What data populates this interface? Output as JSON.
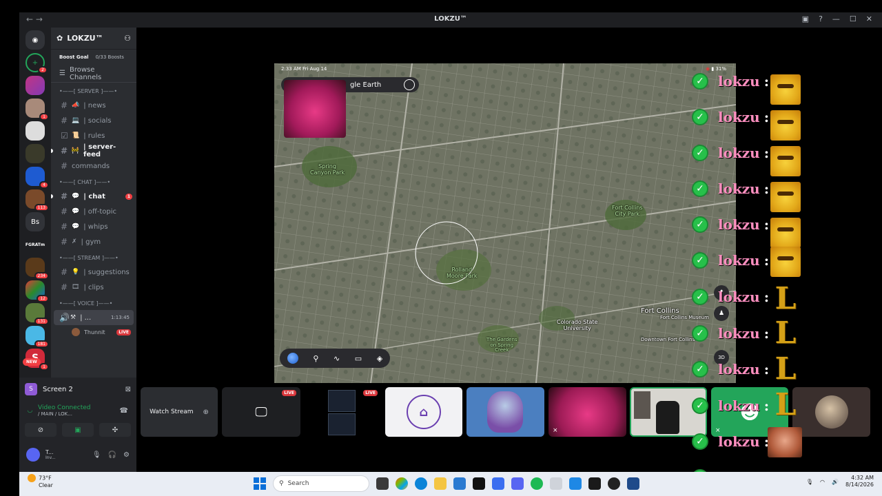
{
  "window": {
    "title": "LOKZU™",
    "back": "←",
    "forward": "→"
  },
  "guild_rail": {
    "badges": [
      "2",
      "1",
      "4",
      "113",
      "234",
      "12",
      "131",
      "181",
      "1"
    ],
    "bs_label": "Bs",
    "grat_label": "FGRATm",
    "new_label": "NEW"
  },
  "server": {
    "name": "LOKZU™",
    "boost_goal": "Boost Goal",
    "boost_count": "0/33 Boosts",
    "browse": "Browse Channels"
  },
  "categories": {
    "server": "•——[ SERVER ]——•",
    "chat": "•——[ CHAT ]——•",
    "stream": "•——[ STREAM ]——•",
    "voice": "•——[ VOICE ]——•"
  },
  "channels": {
    "news": "| news",
    "socials": "| socials",
    "rules": "| rules",
    "server_feed": "| server-feed",
    "commands": "commands",
    "chat": "| chat",
    "chat_mentions": "1",
    "off_topic": "| off-topic",
    "whips": "| whips",
    "gym": "| gym",
    "suggestions": "| suggestions",
    "clips": "| clips",
    "voice_name": "| ...",
    "voice_time": "1:13:45",
    "voice_user": "Thunnit",
    "live": "LIVE"
  },
  "panel": {
    "screen_label": "Screen 2",
    "status": "Video Connected",
    "sub": "/ MAIN / LOK...",
    "user_name": "T...",
    "user_sub": "Inv..."
  },
  "map": {
    "time": "2:33 AM  Fri Aug 14",
    "battery": "31%",
    "search_text": "gle Earth",
    "labels": {
      "spring_canyon": "Spring\nCanyon Park",
      "fort_collins_city_park": "Fort Collins\nCity Park",
      "rolland_moore": "Rolland\nMoore Park",
      "colorado_state": "Colorado State\nUniversity",
      "fort_collins": "Fort Collins",
      "museum": "Fort Collins Museum",
      "downtown": "Downtown Fort Collins",
      "gardens": "The Gardens\non Spring\nCreek"
    },
    "btn_3d": "3D"
  },
  "tiles": {
    "watch": "Watch Stream",
    "live": "LIVE"
  },
  "chat_overlay": {
    "username": "lokzu",
    "colon": ":",
    "emote_L": "L"
  },
  "taskbar": {
    "temp": "73°F",
    "weather": "Clear",
    "search": "Search",
    "time": "4:32 AM",
    "date": "8/14/2026"
  }
}
